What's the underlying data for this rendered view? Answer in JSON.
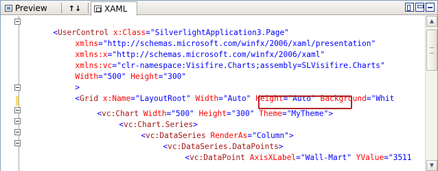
{
  "tabs": {
    "preview_label": "Preview",
    "swap_label": "↑↓",
    "xaml_label": "XAML"
  },
  "window_buttons": [
    "vertical-split-icon",
    "horizontal-split-icon",
    "collapse-pane-icon"
  ],
  "code": {
    "l1": {
      "br": "<",
      "el": "UserControl",
      "sp": " ",
      "at": "x:Class",
      "eq": "=",
      "val": "\"SilverlightApplication3.Page\""
    },
    "l2": {
      "at": "xmlns",
      "eq": "=",
      "val": "\"http://schemas.microsoft.com/winfx/2006/xaml/presentation\""
    },
    "l3": {
      "at": "xmlns:x",
      "eq": "=",
      "val": "\"http://schemas.microsoft.com/winfx/2006/xaml\""
    },
    "l4": {
      "at": "xmlns:vc",
      "eq": "=",
      "val": "\"clr-namespace:Visifire.Charts;assembly=SLVisifire.Charts\""
    },
    "l5": {
      "at1": "Width",
      "eq1": "=",
      "val1": "\"500\"",
      "sp": " ",
      "at2": "Height",
      "eq2": "=",
      "val2": "\"300\""
    },
    "l6": {
      "br": ">"
    },
    "l7": {
      "br": "<",
      "el": "Grid",
      "at1": " x:Name",
      "eq1": "=",
      "val1": "\"LayoutRoot\"",
      "at2": " Width",
      "eq2": "=",
      "val2": "\"Auto\"",
      "at3": " Height",
      "eq3": "=",
      "val3": "\"Auto\"",
      "at4": " Background",
      "eq4": "=",
      "val4": "\"Whit"
    },
    "l8": {
      "br": "<",
      "el": "vc:Chart",
      "at1": " Width",
      "eq1": "=",
      "val1": "\"500\"",
      "at2": " Height",
      "eq2": "=",
      "val2": "\"300\"",
      "at3": " Theme",
      "eq3": "=",
      "val3": "\"MyTheme\"",
      "br2": ">"
    },
    "l9": {
      "br": "<",
      "el": "vc:Chart.Series",
      "br2": ">"
    },
    "l10": {
      "br": "<",
      "el": "vc:DataSeries",
      "at1": " RenderAs",
      "eq1": "=",
      "val1": "\"Column\"",
      "br2": ">"
    },
    "l11": {
      "br": "<",
      "el": "vc:DataSeries.DataPoints",
      "br2": ">"
    },
    "l12": {
      "br": "<",
      "el": "vc:DataPoint",
      "at1": " AxisXLabel",
      "eq1": "=",
      "val1": "\"Wall-Mart\"",
      "at2": " YValue",
      "eq2": "=",
      "val2": "\"3511"
    }
  },
  "colors": {
    "bracket": "#0000ff",
    "element": "#a31515",
    "attribute": "#ff0000",
    "value": "#0000ff",
    "highlight_border": "#b22222"
  }
}
